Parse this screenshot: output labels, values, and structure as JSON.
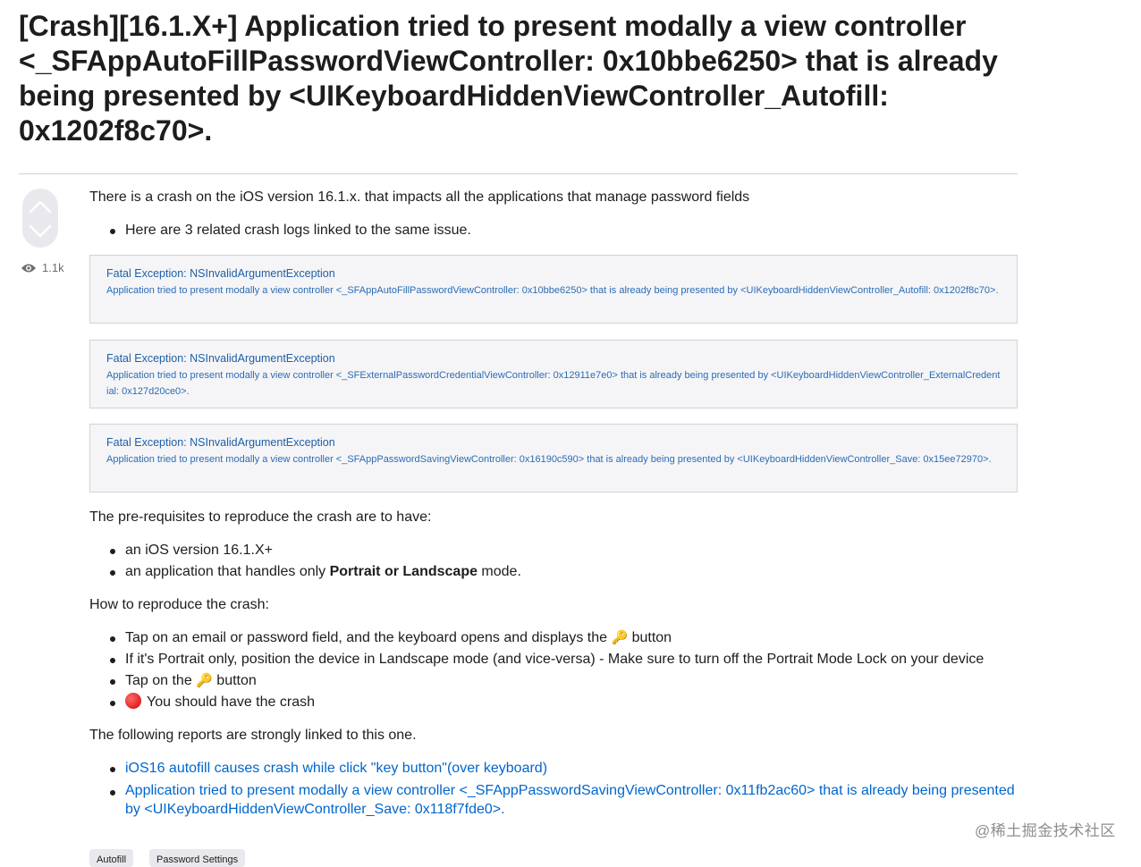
{
  "title": "[Crash][16.1.X+] Application tried to present modally a view controller <_SFAppAutoFillPasswordViewController: 0x10bbe6250> that is already being presented by <UIKeyboardHiddenViewController_Autofill: 0x1202f8c70>.",
  "views": "1.1k",
  "intro": "There is a crash on the iOS version 16.1.x. that impacts all the applications that manage password fields",
  "intro_bullet": "Here are 3 related crash logs linked to the same issue.",
  "crash_logs": [
    {
      "title": "Fatal Exception: NSInvalidArgumentException",
      "body": "Application tried to present modally a view controller <_SFAppAutoFillPasswordViewController: 0x10bbe6250> that is already being presented by <UIKeyboardHiddenViewController_Autofill: 0x1202f8c70>."
    },
    {
      "title": "Fatal Exception: NSInvalidArgumentException",
      "body": "Application tried to present modally a view controller <_SFExternalPasswordCredentialViewController: 0x12911e7e0> that is already being presented by <UIKeyboardHiddenViewController_ExternalCredential: 0x127d20ce0>."
    },
    {
      "title": "Fatal Exception: NSInvalidArgumentException",
      "body": "Application tried to present modally a view controller <_SFAppPasswordSavingViewController: 0x16190c590> that is already being presented by <UIKeyboardHiddenViewController_Save: 0x15ee72970>."
    }
  ],
  "prereq_heading": "The pre-requisites to reproduce the crash are to have:",
  "prereqs": {
    "item1": "an iOS version 16.1.X+",
    "item2_before": "an application that handles only ",
    "item2_bold": "Portrait or Landscape",
    "item2_after": " mode."
  },
  "howto_heading": "How to reproduce the crash:",
  "steps": {
    "step1_before": "Tap on an email or password field, and the keyboard opens and displays the ",
    "step1_after": " button",
    "step2": "If it's Portrait only, position the device in Landscape mode (and vice-versa) - Make sure to turn off the Portrait Mode Lock on your device",
    "step3_before": "Tap on the ",
    "step3_after": " button",
    "step4": "You should have the crash",
    "key_emoji": "🔑",
    "key_icon": "key-emoji",
    "red_circle_icon": "red-circle-emoji"
  },
  "related_heading": "The following reports are strongly linked to this one.",
  "related_links": [
    "iOS16 autofill causes crash while click \"key button\"(over keyboard)",
    "Application tried to present modally a view controller <_SFAppPasswordSavingViewController: 0x11fb2ac60> that is already being presented by <UIKeyboardHiddenViewController_Save: 0x118f7fde0>."
  ],
  "tags": [
    "Autofill",
    "Password Settings"
  ],
  "watermark": "@稀土掘金技术社区",
  "colors": {
    "link": "#0066cc",
    "code_text": "#2b6cb6",
    "code_bg": "#f5f5f7"
  }
}
